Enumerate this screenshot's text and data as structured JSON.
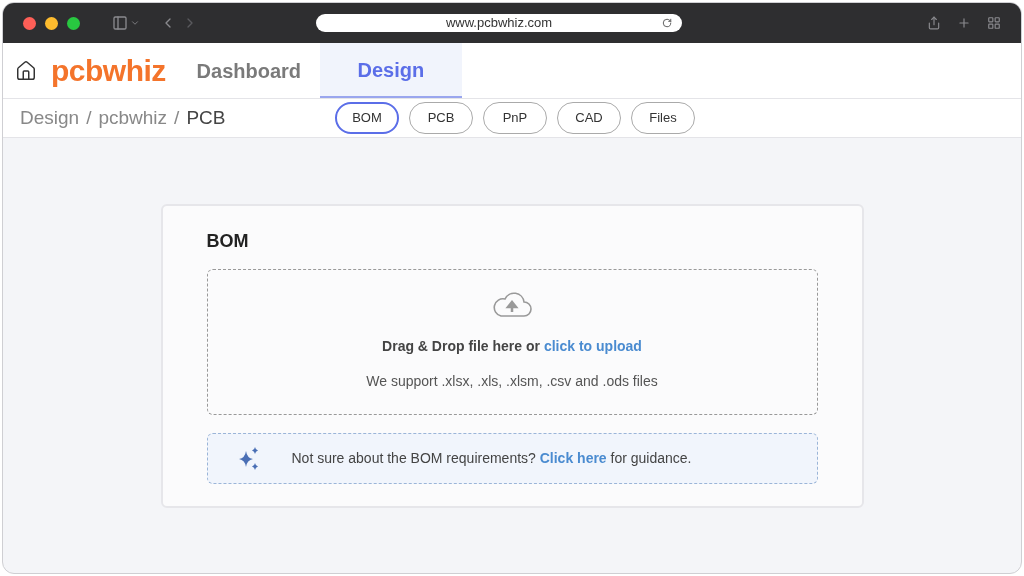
{
  "browser": {
    "url": "www.pcbwhiz.com"
  },
  "logo": "pcbwhiz",
  "nav_tabs": [
    {
      "label": "Dashboard",
      "selected": false
    },
    {
      "label": "Design",
      "selected": true
    }
  ],
  "breadcrumb": {
    "separator": "/",
    "items": [
      "Design",
      "pcbwhiz",
      "PCB"
    ]
  },
  "sub_tabs": [
    {
      "label": "BOM",
      "selected": true
    },
    {
      "label": "PCB",
      "selected": false
    },
    {
      "label": "PnP",
      "selected": false
    },
    {
      "label": "CAD",
      "selected": false
    },
    {
      "label": "Files",
      "selected": false
    }
  ],
  "card": {
    "title": "BOM",
    "drop_zone": {
      "prompt": "Drag & Drop file here or ",
      "link": "click to upload",
      "note": "We support .xlsx, .xls, .xlsm, .csv and .ods files"
    },
    "guidance": {
      "before": "Not sure about the BOM requirements? ",
      "link": "Click here",
      "after": " for guidance."
    }
  }
}
